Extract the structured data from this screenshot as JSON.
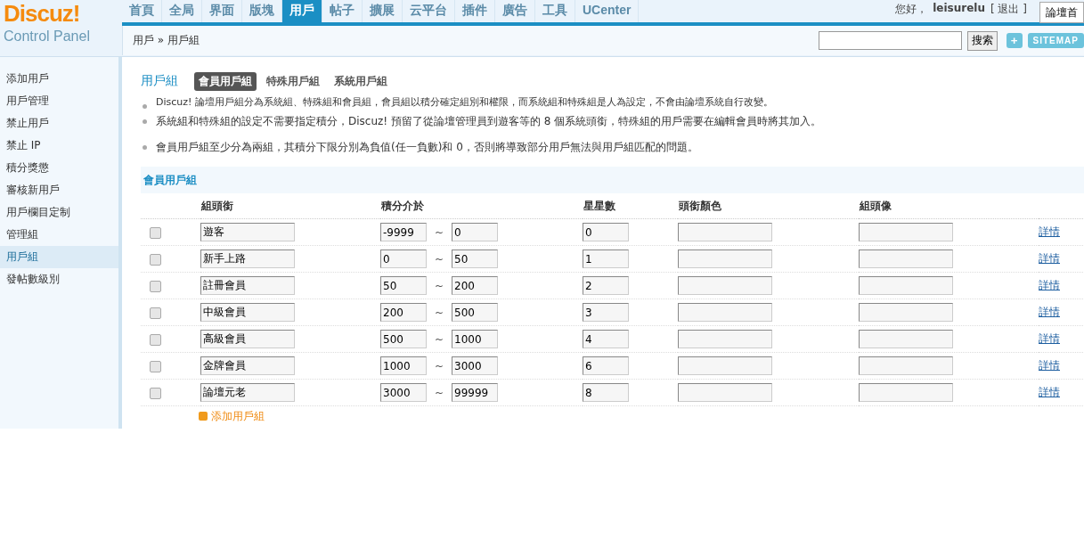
{
  "logo": {
    "brand": "Discuz!",
    "subtitle": "Control Panel"
  },
  "nav": [
    {
      "label": "首頁",
      "selected": false
    },
    {
      "label": "全局",
      "selected": false
    },
    {
      "label": "界面",
      "selected": false
    },
    {
      "label": "版塊",
      "selected": false
    },
    {
      "label": "用戶",
      "selected": true
    },
    {
      "label": "帖子",
      "selected": false
    },
    {
      "label": "擴展",
      "selected": false
    },
    {
      "label": "云平台",
      "selected": false
    },
    {
      "label": "插件",
      "selected": false
    },
    {
      "label": "廣告",
      "selected": false
    },
    {
      "label": "工具",
      "selected": false
    },
    {
      "label": "UCenter",
      "selected": false
    }
  ],
  "user": {
    "greeting": "您好，",
    "name": "leisurelu",
    "logout": "[ 退出 ]",
    "home_button": "論壇首"
  },
  "breadcrumb": "用戶 » 用戶組",
  "search": {
    "button": "搜索",
    "add": "+",
    "sitemap": "SITEMAP"
  },
  "sidebar": [
    {
      "label": "添加用戶",
      "selected": false
    },
    {
      "label": "用戶管理",
      "selected": false
    },
    {
      "label": "禁止用戶",
      "selected": false
    },
    {
      "label": "禁止 IP",
      "selected": false
    },
    {
      "label": "積分獎懲",
      "selected": false
    },
    {
      "label": "審核新用戶",
      "selected": false
    },
    {
      "label": "用戶欄目定制",
      "selected": false
    },
    {
      "label": "管理組",
      "selected": false
    },
    {
      "label": "用戶組",
      "selected": true
    },
    {
      "label": "發帖數級別",
      "selected": false
    }
  ],
  "page_title": "用戶組",
  "tabs": [
    {
      "label": "會員用戶組",
      "selected": true
    },
    {
      "label": "特殊用戶組",
      "selected": false
    },
    {
      "label": "系統用戶組",
      "selected": false
    }
  ],
  "tips": [
    "Discuz! 論壇用戶組分為系統組、特殊組和會員組，會員組以積分確定組別和權限，而系統組和特殊組是人為設定，不會由論壇系統自行改變。",
    "系統組和特殊組的設定不需要指定積分，Discuz! 預留了從論壇管理員到遊客等的 8 個系統頭銜，特殊組的用戶需要在編輯會員時將其加入。",
    "會員用戶組至少分為兩組，其積分下限分別為負值(任一負數)和 0，否則將導致部分用戶無法與用戶組匹配的問題。"
  ],
  "section_title": "會員用戶組",
  "table": {
    "columns": [
      "組頭銜",
      "積分介於",
      "星星數",
      "頭銜顏色",
      "組頭像"
    ],
    "rows": [
      {
        "checked": false,
        "title": "遊客",
        "min": "-9999",
        "max": "0",
        "stars": "0",
        "link": "詳情"
      },
      {
        "checked": false,
        "title": "新手上路",
        "min": "0",
        "max": "50",
        "stars": "1",
        "link": "詳情"
      },
      {
        "checked": false,
        "title": "註冊會員",
        "min": "50",
        "max": "200",
        "stars": "2",
        "link": "詳情"
      },
      {
        "checked": false,
        "title": "中級會員",
        "min": "200",
        "max": "500",
        "stars": "3",
        "link": "詳情"
      },
      {
        "checked": false,
        "title": "高級會員",
        "min": "500",
        "max": "1000",
        "stars": "4",
        "link": "詳情"
      },
      {
        "checked": false,
        "title": "金牌會員",
        "min": "1000",
        "max": "3000",
        "stars": "6",
        "link": "詳情"
      },
      {
        "checked": false,
        "title": "論壇元老",
        "min": "3000",
        "max": "99999",
        "stars": "8",
        "link": "詳情"
      }
    ],
    "separator": "~",
    "add_label": "添加用戶組"
  }
}
